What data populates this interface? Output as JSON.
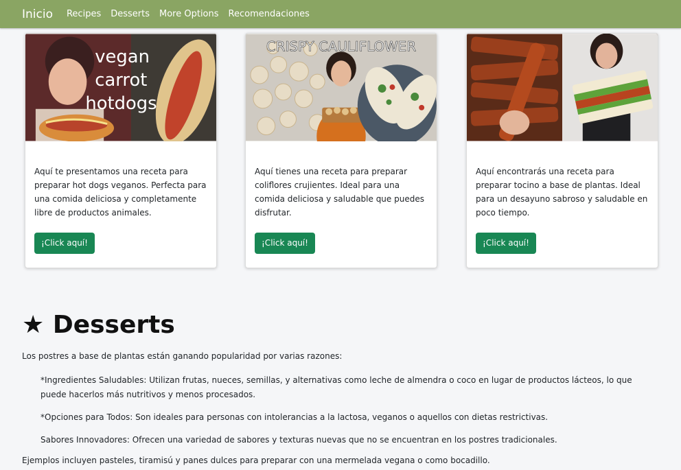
{
  "navbar": {
    "brand": "Inicio",
    "links": [
      "Recipes",
      "Desserts",
      "More Options",
      "Recomendaciones"
    ]
  },
  "cards": [
    {
      "image_text": [
        "vegan",
        "carrot",
        "hotdogs"
      ],
      "text": "Aquí te presentamos una receta para preparar hot dogs veganos. Perfecta para una comida deliciosa y completamente libre de productos animales.",
      "button": "¡Click aquí!"
    },
    {
      "image_text": [
        "CRISPY CAULIFLOWER"
      ],
      "text": "Aquí tienes una receta para preparar coliflores crujientes. Ideal para una comida deliciosa y saludable que puedes disfrutar.",
      "button": "¡Click aquí!"
    },
    {
      "image_text": [],
      "text": "Aquí encontrarás una receta para preparar tocino a base de plantas. Ideal para un desayuno sabroso y saludable en poco tiempo.",
      "button": "¡Click aquí!"
    }
  ],
  "desserts": {
    "icon": "star-icon",
    "star": "★",
    "title": "Desserts",
    "intro": "Los postres a base de plantas están ganando popularidad por varias razones:",
    "reasons": [
      "*Ingredientes Saludables: Utilizan frutas, nueces, semillas, y alternativas como leche de almendra o coco en lugar de productos lácteos, lo que puede hacerlos más nutritivos y menos procesados.",
      "*Opciones para Todos: Son ideales para personas con intolerancias a la lactosa, veganos o aquellos con dietas restrictivas.",
      "Sabores Innovadores: Ofrecen una variedad de sabores y texturas nuevas que no se encuentran en los postres tradicionales."
    ],
    "example": "Ejemplos incluyen pasteles, tiramisú y panes dulces para preparar con una mermelada vegana o como bocadillo."
  },
  "colors": {
    "navbar": "#8aa563",
    "button": "#198754",
    "background": "#f5f6f8"
  }
}
